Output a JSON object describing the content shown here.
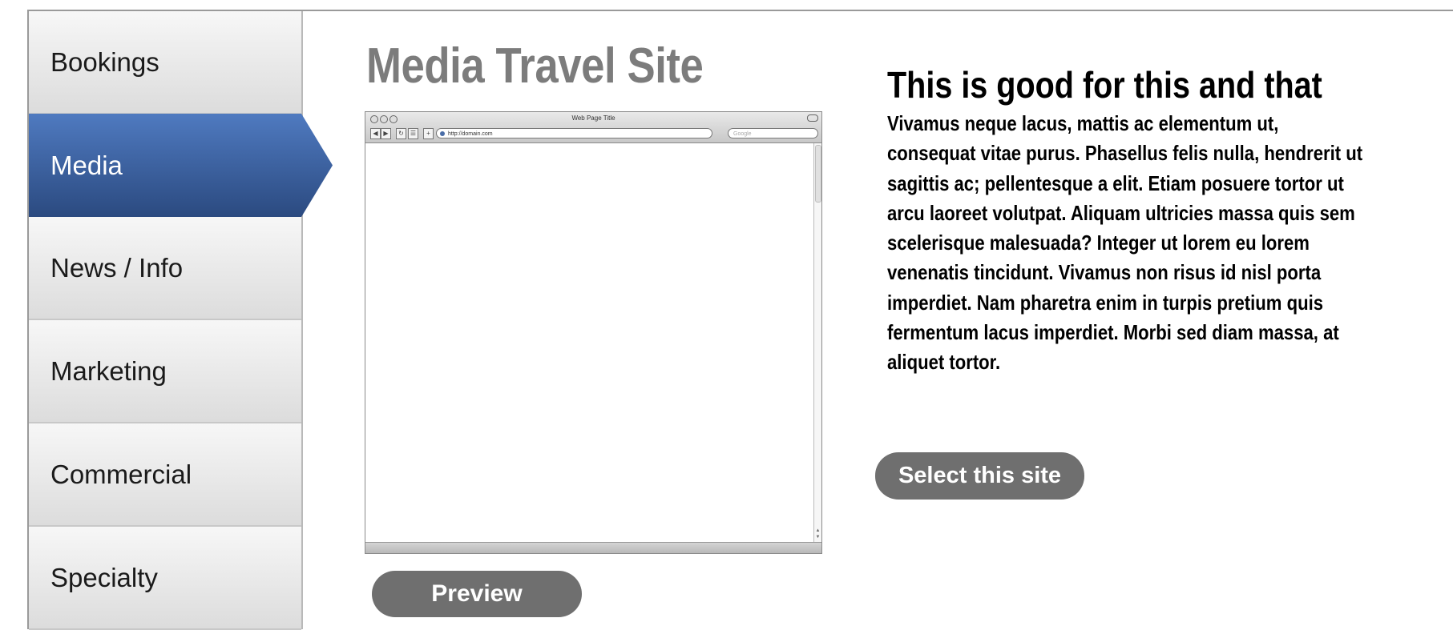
{
  "sidebar": {
    "items": [
      {
        "label": "Bookings",
        "active": false
      },
      {
        "label": "Media",
        "active": true
      },
      {
        "label": "News / Info",
        "active": false
      },
      {
        "label": "Marketing",
        "active": false
      },
      {
        "label": "Commercial",
        "active": false
      },
      {
        "label": "Specialty",
        "active": false
      }
    ]
  },
  "main": {
    "title": "Media Travel Site",
    "browser": {
      "window_title": "Web Page Title",
      "url": "http://domain.com",
      "search_placeholder": "Google"
    },
    "preview_label": "Preview"
  },
  "details": {
    "headline": "This is good for this and that",
    "body": "Vivamus neque lacus, mattis ac elementum ut, consequat vitae purus. Phasellus felis nulla, hendrerit ut sagittis ac; pellentesque a elit. Etiam posuere tortor ut arcu laoreet volutpat. Aliquam ultricies massa quis sem scelerisque malesuada? Integer ut lorem eu lorem venenatis tincidunt. Vivamus non risus id nisl porta imperdiet. Nam pharetra enim in turpis pretium quis fermentum lacus imperdiet. Morbi sed diam massa, at aliquet tortor.",
    "select_label": "Select this site"
  },
  "colors": {
    "active_nav": "#3a5f9f",
    "button": "#6f6f6f",
    "title": "#7c7c7c"
  }
}
